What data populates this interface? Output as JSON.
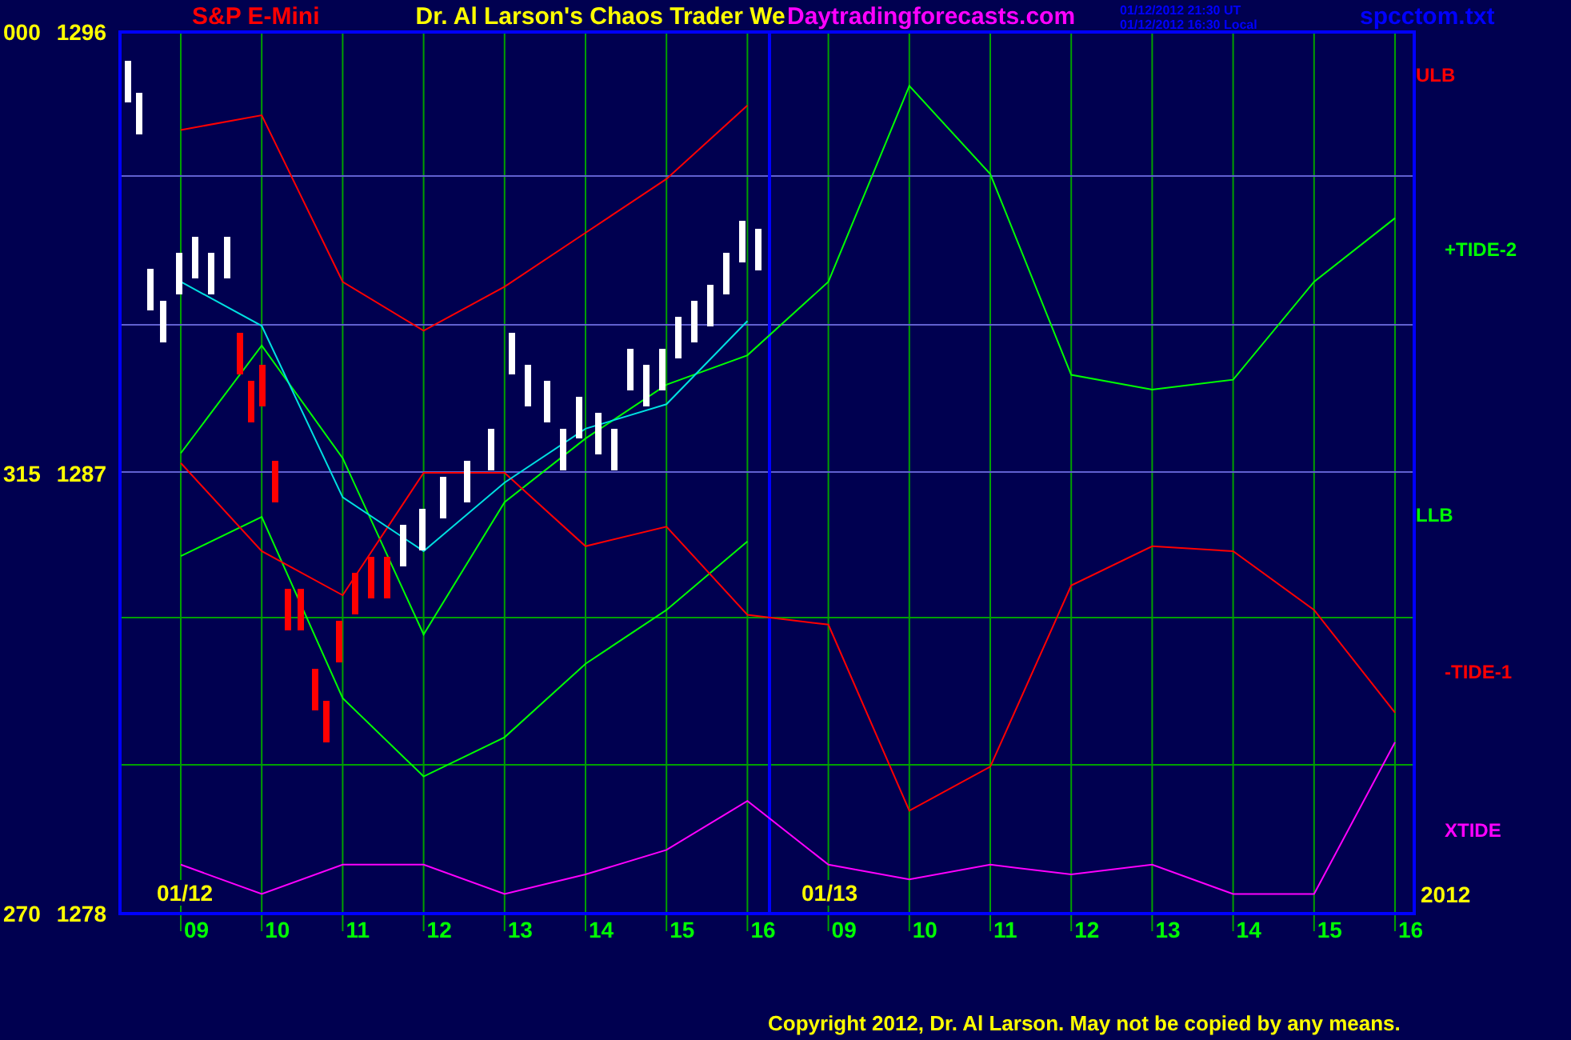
{
  "header": {
    "symbol": "S&P E-Mini",
    "title": "Dr. Al Larson's Chaos Trader We",
    "site": "Daytradingforecasts.com",
    "timestamps": [
      "01/12/2012 21:30 UT",
      "01/12/2012 16:30 Local"
    ],
    "file": "spcctom.txt"
  },
  "y_codes": [
    "000",
    "315",
    "270"
  ],
  "chart_data": {
    "type": "line",
    "categories": [
      "09",
      "10",
      "11",
      "12",
      "13",
      "14",
      "15",
      "16",
      "09",
      "10",
      "11",
      "12",
      "13",
      "14",
      "15",
      "16"
    ],
    "series": [
      {
        "name": "ULB",
        "color": "#ff0000",
        "values": [
          1294.0,
          1294.3,
          1290.9,
          1289.9,
          1290.8,
          1291.9,
          1293.0,
          1294.5,
          null,
          null,
          null,
          null,
          null,
          null,
          null,
          null
        ]
      },
      {
        "name": "+TIDE-2",
        "color": "#00ff00",
        "values": [
          1287.4,
          1289.6,
          1287.3,
          1283.7,
          1286.4,
          1287.7,
          1288.8,
          1289.4,
          1290.9,
          1294.9,
          1293.1,
          1289.0,
          1288.7,
          1288.9,
          1290.9,
          1292.2
        ]
      },
      {
        "name": "LLB",
        "color": "#00ff00",
        "values": [
          1285.3,
          1286.1,
          1282.4,
          1280.8,
          1281.6,
          1283.1,
          1284.2,
          1285.6,
          null,
          null,
          null,
          null,
          null,
          null,
          null,
          null
        ]
      },
      {
        "name": "-TIDE-1",
        "color": "#ff0000",
        "values": [
          1287.2,
          1285.4,
          1284.5,
          1287.0,
          1287.0,
          1285.5,
          1285.9,
          1284.1,
          1283.9,
          1280.1,
          1281.0,
          1284.7,
          1285.5,
          1285.4,
          1284.2,
          1282.1
        ]
      },
      {
        "name": "XTIDE",
        "color": "#ff00ff",
        "values": [
          1279.0,
          1278.4,
          1279.0,
          1279.0,
          1278.4,
          1278.8,
          1279.3,
          1280.3,
          1279.0,
          1278.7,
          1279.0,
          1278.8,
          1279.0,
          1278.4,
          1278.4,
          1281.5
        ]
      },
      {
        "color": "#00e0e0",
        "values": [
          1290.9,
          1290.0,
          1286.5,
          1285.4,
          1286.8,
          1287.9,
          1288.4,
          1290.1,
          null,
          null,
          null,
          null,
          null,
          null,
          null,
          null
        ]
      }
    ],
    "ylim": [
      1278,
      1296
    ],
    "yticks": [
      {
        "value": 1296,
        "label": "1296"
      },
      {
        "value": 1287,
        "label": "1287"
      },
      {
        "value": 1278,
        "label": "1278"
      }
    ]
  },
  "date_labels": [
    "01/12",
    "01/13"
  ],
  "year": "2012",
  "copyright": "Copyright 2012, Dr. Al Larson. May not be copied by any means."
}
